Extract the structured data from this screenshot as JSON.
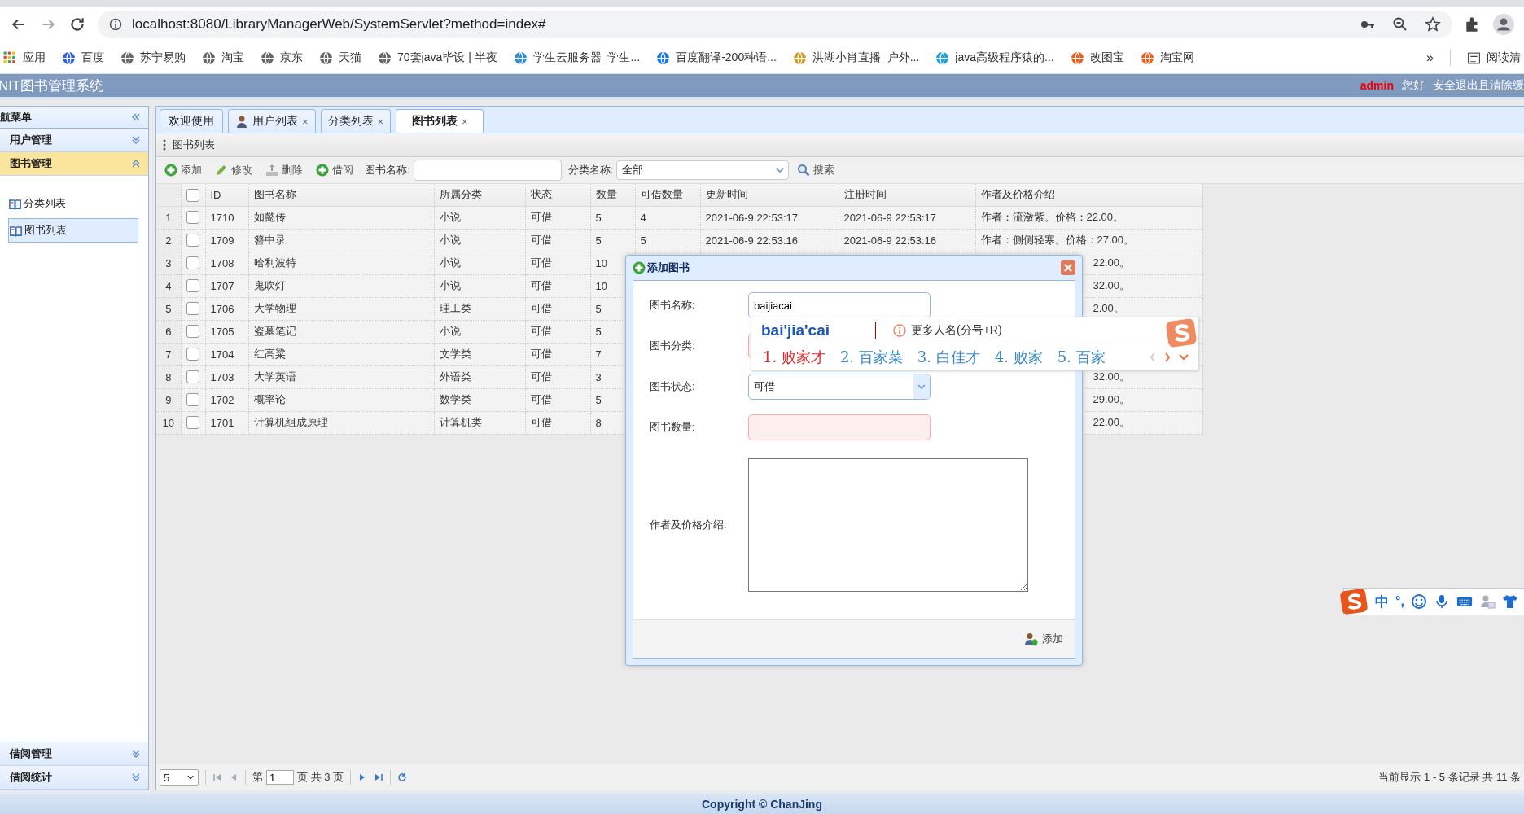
{
  "browser": {
    "url": "localhost:8080/LibraryManagerWeb/SystemServlet?method=index#",
    "bookmarks": [
      {
        "label": "应用"
      },
      {
        "label": "百度"
      },
      {
        "label": "苏宁易购"
      },
      {
        "label": "淘宝"
      },
      {
        "label": "京东"
      },
      {
        "label": "天猫"
      },
      {
        "label": "70套java毕设 | 半夜"
      },
      {
        "label": "学生云服务器_学生..."
      },
      {
        "label": "百度翻译-200种语..."
      },
      {
        "label": "洪湖小肖直播_户外..."
      },
      {
        "label": "java高级程序猿的..."
      },
      {
        "label": "改图宝"
      },
      {
        "label": "淘宝网"
      }
    ],
    "overflow": "»",
    "reading_list": "阅读清"
  },
  "app": {
    "title": "NIT图书管理系统",
    "user": "admin",
    "greeting": "您好",
    "logout": "安全退出且清除缓"
  },
  "sidebar": {
    "title": "航菜单",
    "sections": [
      {
        "label": "用户管理",
        "expanded": false
      },
      {
        "label": "图书管理",
        "expanded": true,
        "items": [
          {
            "label": "分类列表",
            "selected": false
          },
          {
            "label": "图书列表",
            "selected": true
          }
        ]
      },
      {
        "label": "借阅管理",
        "expanded": false
      },
      {
        "label": "借阅统计",
        "expanded": false
      }
    ]
  },
  "tabs": [
    {
      "label": "欢迎使用",
      "kind": "plain",
      "selected": false
    },
    {
      "label": "用户列表",
      "kind": "user",
      "close": "×",
      "selected": false
    },
    {
      "label": "分类列表",
      "kind": "plain",
      "close": "×",
      "selected": false
    },
    {
      "label": "图书列表",
      "kind": "plain",
      "close": "×",
      "selected": true
    }
  ],
  "panel_title": "图书列表",
  "toolbar": {
    "buttons": [
      {
        "label": "添加",
        "kind": "add"
      },
      {
        "label": "修改",
        "kind": "edit"
      },
      {
        "label": "删除",
        "kind": "delete"
      },
      {
        "label": "借阅",
        "kind": "borrow"
      }
    ],
    "name_label": "图书名称:",
    "category_label": "分类名称:",
    "category_value": "全部",
    "search": "搜索"
  },
  "table": {
    "all_checked": false,
    "columns": [
      "ID",
      "图书名称",
      "所属分类",
      "状态",
      "数量",
      "可借数量",
      "更新时间",
      "注册时间",
      "作者及价格介绍"
    ],
    "rows": [
      {
        "index": "1",
        "checked": false,
        "cells": [
          "1710",
          "如懿传",
          "小说",
          "可借",
          "5",
          "4",
          "2021-06-9 22:53:17",
          "2021-06-9 22:53:17",
          "作者：流潋紫。价格：22.00。"
        ]
      },
      {
        "index": "2",
        "checked": false,
        "cells": [
          "1709",
          "簪中录",
          "小说",
          "可借",
          "5",
          "5",
          "2021-06-9 22:53:16",
          "2021-06-9 22:53:16",
          "作者：侧侧轻寒。价格：27.00。"
        ]
      },
      {
        "index": "3",
        "checked": false,
        "cells": [
          "1708",
          "哈利波特",
          "小说",
          "可借",
          "10"
        ],
        "author_tail": "22.00。"
      },
      {
        "index": "4",
        "checked": false,
        "cells": [
          "1707",
          "鬼吹灯",
          "小说",
          "可借",
          "10"
        ],
        "author_tail": "32.00。"
      },
      {
        "index": "5",
        "checked": false,
        "cells": [
          "1706",
          "大学物理",
          "理工类",
          "可借",
          "5"
        ],
        "author_tail": "2.00。"
      },
      {
        "index": "6",
        "checked": false,
        "cells": [
          "1705",
          "盗墓笔记",
          "小说",
          "可借",
          "5"
        ]
      },
      {
        "index": "7",
        "checked": false,
        "cells": [
          "1704",
          "红高粱",
          "文学类",
          "可借",
          "7"
        ]
      },
      {
        "index": "8",
        "checked": false,
        "cells": [
          "1703",
          "大学英语",
          "外语类",
          "可借",
          "3"
        ],
        "author_tail": "32.00。"
      },
      {
        "index": "9",
        "checked": false,
        "cells": [
          "1702",
          "概率论",
          "数学类",
          "可借",
          "5"
        ],
        "author_tail": "29.00。"
      },
      {
        "index": "10",
        "checked": false,
        "cells": [
          "1701",
          "计算机组成原理",
          "计算机类",
          "可借",
          "8"
        ],
        "author_tail": "22.00。"
      }
    ]
  },
  "pager": {
    "page_size": "5",
    "page_prefix": "第",
    "page": "1",
    "page_suffix": "页 共 3 页",
    "summary": "当前显示 1 - 5 条记录 共 11 条"
  },
  "dialog": {
    "title": "添加图书",
    "fields": [
      {
        "label": "图书名称:",
        "kind": "text",
        "value": "baijiacai",
        "invalid": false
      },
      {
        "label": "图书分类:",
        "kind": "text",
        "invalid": true
      },
      {
        "label": "图书状态:",
        "kind": "select",
        "value": "可借"
      },
      {
        "label": "图书数量:",
        "kind": "text",
        "invalid": true
      },
      {
        "label": "作者及价格介绍:",
        "kind": "textarea"
      }
    ],
    "submit": "添加"
  },
  "ime": {
    "composition": "bai'jia'cai",
    "hint": "更多人名(分号+R)",
    "candidates": [
      {
        "text": "1. 败家才",
        "selected": true
      },
      {
        "text": "2. 百家菜",
        "selected": false
      },
      {
        "text": "3. 白佳才",
        "selected": false
      },
      {
        "text": "4. 败家",
        "selected": false
      },
      {
        "text": "5. 百家",
        "selected": false
      }
    ],
    "mode": "中",
    "punct": "°,"
  },
  "footer": "Copyright © ChanJing"
}
